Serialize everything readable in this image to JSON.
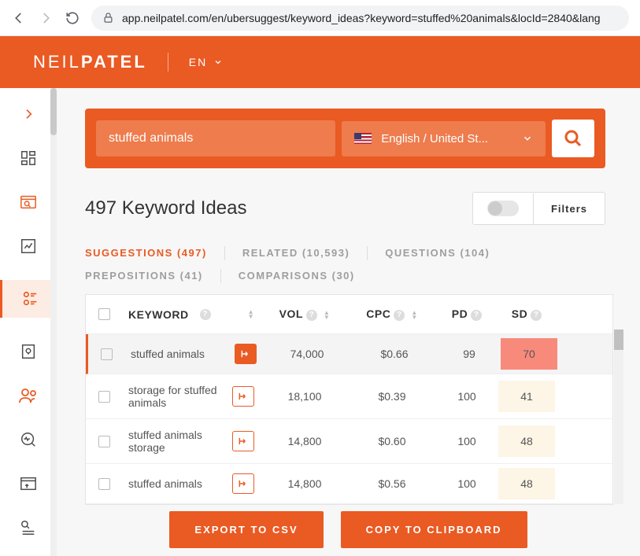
{
  "browser": {
    "url_display": "app.neilpatel.com/en/ubersuggest/keyword_ideas?keyword=stuffed%20animals&locId=2840&lang"
  },
  "header": {
    "logo_thin": "NEIL",
    "logo_bold": "PATEL",
    "lang": "EN"
  },
  "search": {
    "keyword": "stuffed animals",
    "locale": "English / United St..."
  },
  "title": "497 Keyword Ideas",
  "filters_label": "Filters",
  "tabs": [
    {
      "label": "SUGGESTIONS (497)",
      "active": true
    },
    {
      "label": "RELATED (10,593)",
      "active": false
    },
    {
      "label": "QUESTIONS (104)",
      "active": false
    },
    {
      "label": "PREPOSITIONS (41)",
      "active": false
    },
    {
      "label": "COMPARISONS (30)",
      "active": false
    }
  ],
  "columns": {
    "keyword": "KEYWORD",
    "vol": "VOL",
    "cpc": "CPC",
    "pd": "PD",
    "sd": "SD"
  },
  "rows": [
    {
      "keyword": "stuffed animals",
      "vol": "74,000",
      "cpc": "$0.66",
      "pd": "99",
      "sd": "70",
      "sd_class": "sd-red",
      "btn_filled": true
    },
    {
      "keyword": "storage for stuffed animals",
      "vol": "18,100",
      "cpc": "$0.39",
      "pd": "100",
      "sd": "41",
      "sd_class": "sd-yel",
      "btn_filled": false
    },
    {
      "keyword": "stuffed animals storage",
      "vol": "14,800",
      "cpc": "$0.60",
      "pd": "100",
      "sd": "48",
      "sd_class": "sd-yel",
      "btn_filled": false
    },
    {
      "keyword": "stuffed animals",
      "vol": "14,800",
      "cpc": "$0.56",
      "pd": "100",
      "sd": "48",
      "sd_class": "sd-yel",
      "btn_filled": false
    }
  ],
  "buttons": {
    "export": "EXPORT TO CSV",
    "copy": "COPY TO CLIPBOARD"
  }
}
